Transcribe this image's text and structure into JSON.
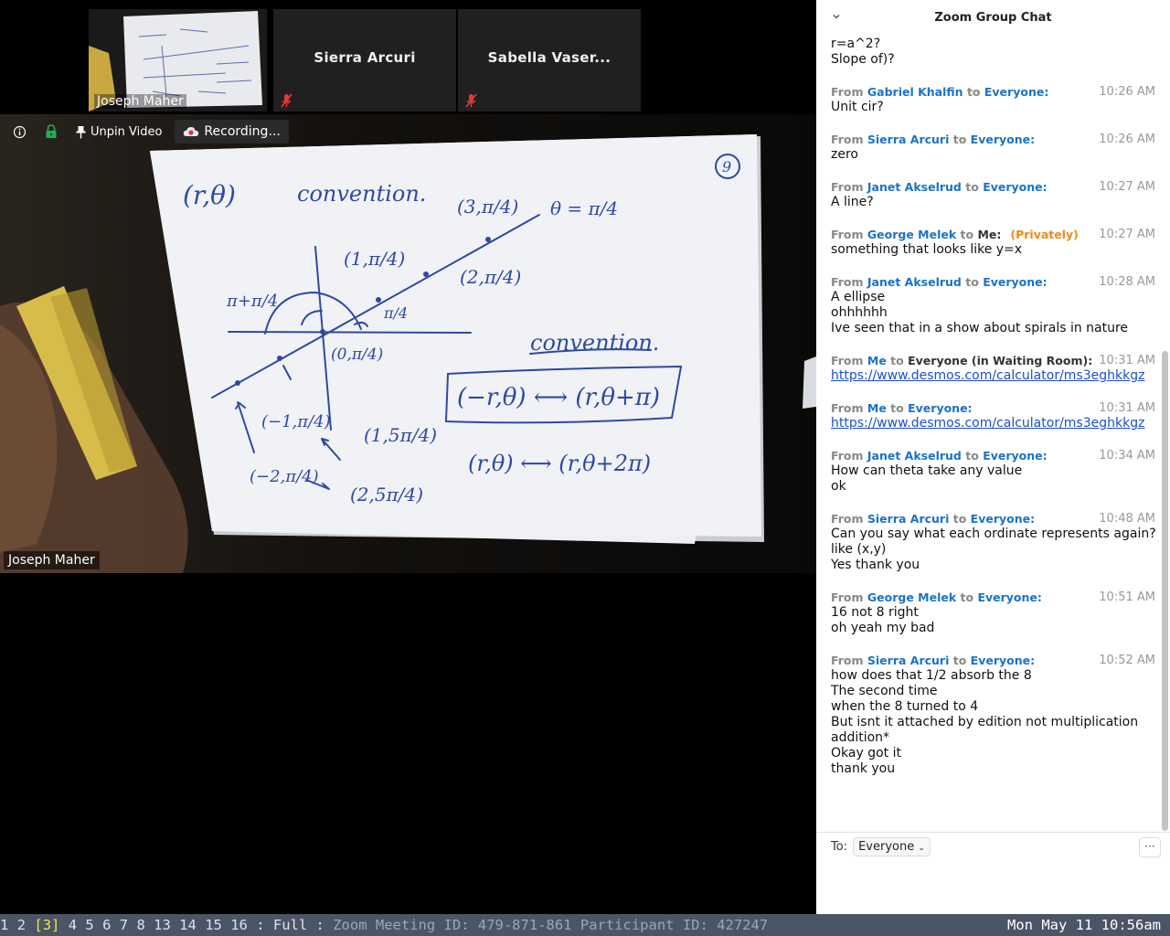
{
  "thumbnails": [
    {
      "name": "Joseph Maher"
    },
    {
      "name": "Sierra Arcuri"
    },
    {
      "name": "Sabella Vaser..."
    }
  ],
  "toolbar": {
    "unpin_label": "Unpin Video",
    "recording_label": "Recording..."
  },
  "main_video": {
    "speaker_name": "Joseph Maher",
    "whiteboard": {
      "page_number": "9",
      "title_left": "(r,θ)",
      "title_mid": "convention.",
      "label_top": "(3,π/4)",
      "label_theta": "θ = π/4",
      "label_1": "(1,π/4)",
      "label_2": "(2,π/4)",
      "label_pi_quarter": "π/4",
      "label_pi_plus": "π+π/4",
      "label_origin": "(0,π/4)",
      "label_neg1": "(−1,π/4)",
      "label_neg2": "(−2,π/4)",
      "label_5pi_1": "(1,5π/4)",
      "label_5pi_2": "(2,5π/4)",
      "convention2": "convention.",
      "box_eq": "(−r,θ) ⟷ (r,θ+π)",
      "eq2": "(r,θ) ⟷ (r,θ+2π)"
    }
  },
  "chat": {
    "title": "Zoom Group Chat",
    "messages": [
      {
        "from_label": "",
        "sender": "",
        "to_label": "",
        "recipient": "",
        "private": "",
        "time": "",
        "lines": [
          "r=a^2?",
          "Slope of)?"
        ]
      },
      {
        "from_label": "From",
        "sender": "Gabriel Khalfin",
        "to_label": "to",
        "recipient": "Everyone:",
        "private": "",
        "time": "10:26 AM",
        "lines": [
          "Unit cir?"
        ]
      },
      {
        "from_label": "From",
        "sender": "Sierra Arcuri",
        "to_label": "to",
        "recipient": "Everyone:",
        "private": "",
        "time": "10:26 AM",
        "lines": [
          "zero"
        ]
      },
      {
        "from_label": "From",
        "sender": "Janet Akselrud",
        "to_label": "to",
        "recipient": "Everyone:",
        "private": "",
        "time": "10:27 AM",
        "lines": [
          "A line?"
        ]
      },
      {
        "from_label": "From",
        "sender": "George Melek",
        "to_label": "to",
        "recipient": "Me:",
        "private": "(Privately)",
        "time": "10:27 AM",
        "lines": [
          "something that looks like y=x"
        ]
      },
      {
        "from_label": "From",
        "sender": "Janet Akselrud",
        "to_label": "to",
        "recipient": "Everyone:",
        "private": "",
        "time": "10:28 AM",
        "lines": [
          "A ellipse",
          "ohhhhhh",
          "Ive seen that in a show about spirals in nature"
        ]
      },
      {
        "from_label": "From",
        "sender": "Me",
        "to_label": "to",
        "recipient": "Everyone (in Waiting Room):",
        "private": "",
        "time": "10:31 AM",
        "lines": [
          "https://www.desmos.com/calculator/ms3eghkkgz"
        ],
        "link": true
      },
      {
        "from_label": "From",
        "sender": "Me",
        "to_label": "to",
        "recipient": "Everyone:",
        "private": "",
        "time": "10:31 AM",
        "lines": [
          "https://www.desmos.com/calculator/ms3eghkkgz"
        ],
        "link": true
      },
      {
        "from_label": "From",
        "sender": "Janet Akselrud",
        "to_label": "to",
        "recipient": "Everyone:",
        "private": "",
        "time": "10:34 AM",
        "lines": [
          "How can theta take any value",
          "ok"
        ]
      },
      {
        "from_label": "From",
        "sender": "Sierra Arcuri",
        "to_label": "to",
        "recipient": "Everyone:",
        "private": "",
        "time": "10:48 AM",
        "lines": [
          "Can you say what each ordinate represents again?",
          "like (x,y)",
          "Yes thank you"
        ]
      },
      {
        "from_label": "From",
        "sender": "George Melek",
        "to_label": "to",
        "recipient": "Everyone:",
        "private": "",
        "time": "10:51 AM",
        "lines": [
          "16 not 8 right",
          "oh yeah my bad"
        ]
      },
      {
        "from_label": "From",
        "sender": "Sierra Arcuri",
        "to_label": "to",
        "recipient": "Everyone:",
        "private": "",
        "time": "10:52 AM",
        "lines": [
          "how does that 1/2 absorb the 8",
          "The second time",
          "when the 8 turned to 4",
          "But isnt it attached by edition not multiplication",
          "addition*",
          "Okay got it",
          "thank you"
        ]
      }
    ],
    "to_label": "To:",
    "to_value": "Everyone",
    "more_label": "···",
    "input_value": ""
  },
  "statusbar": {
    "workspaces": [
      "1",
      "2",
      "[3]",
      "4",
      "5",
      "6",
      "7",
      "8",
      "13",
      "14",
      "15",
      "16"
    ],
    "active_index": 2,
    "layout": ": Full :",
    "window_title": "Zoom Meeting ID: 479-871-861 Participant ID: 427247",
    "clock": "Mon May 11 10:56am"
  },
  "colors": {
    "link_blue": "#1a73c8",
    "private_orange": "#f08a13",
    "status_bg": "#4a5565",
    "active_workspace": "#f7e34a"
  }
}
